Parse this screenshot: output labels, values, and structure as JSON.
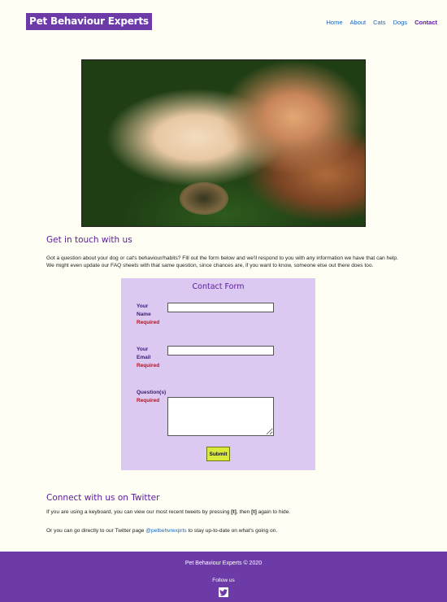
{
  "header": {
    "logo": "Pet Behaviour Experts",
    "nav": [
      {
        "label": "Home",
        "active": false
      },
      {
        "label": "About",
        "active": false
      },
      {
        "label": "Cats",
        "active": false
      },
      {
        "label": "Dogs",
        "active": false
      },
      {
        "label": "Contact",
        "active": true
      }
    ]
  },
  "hero": {
    "alt": "Cat and dog lying together in the grass"
  },
  "contact": {
    "title": "Get in touch with us",
    "intro_line1": "Got a question about your dog or cat's behaviour/habits? Fill out the form below and we'll respond to you with any information we have that can help.",
    "intro_line2": "We might even update our FAQ sheets with that same question, since chances are, if you want to know, someone else out there does too."
  },
  "form": {
    "title": "Contact Form",
    "name_label_1": "Your",
    "name_label_2": "Name",
    "email_label_1": "Your",
    "email_label_2": "Email",
    "question_label": "Question(s)",
    "required_text": "Required",
    "name_value": "",
    "email_value": "",
    "question_value": "",
    "submit_label": "Submit"
  },
  "twitter": {
    "title": "Connect with us on Twitter",
    "kbd_pre": "If you are using a keyboard, you can view our most recent tweets by pressing ",
    "kbd_key1": "[t]",
    "kbd_mid": ", then ",
    "kbd_key2": "[t]",
    "kbd_post": " again to hide.",
    "direct_pre": "Or you can go directly to our Twitter page ",
    "handle": "@petbehvrexprts",
    "direct_post": " to stay up-to-date on what's going on."
  },
  "footer": {
    "copyright": "Pet Behaviour Experts © 2020",
    "follow": "Follow us"
  },
  "colors": {
    "brand": "#6c3ba8",
    "heading": "#5a1a9a",
    "link": "#1565c0",
    "required": "#e00000",
    "form_bg": "#dcc9f2",
    "submit_bg": "#d9ea3a",
    "page_bg": "#fefef4"
  }
}
